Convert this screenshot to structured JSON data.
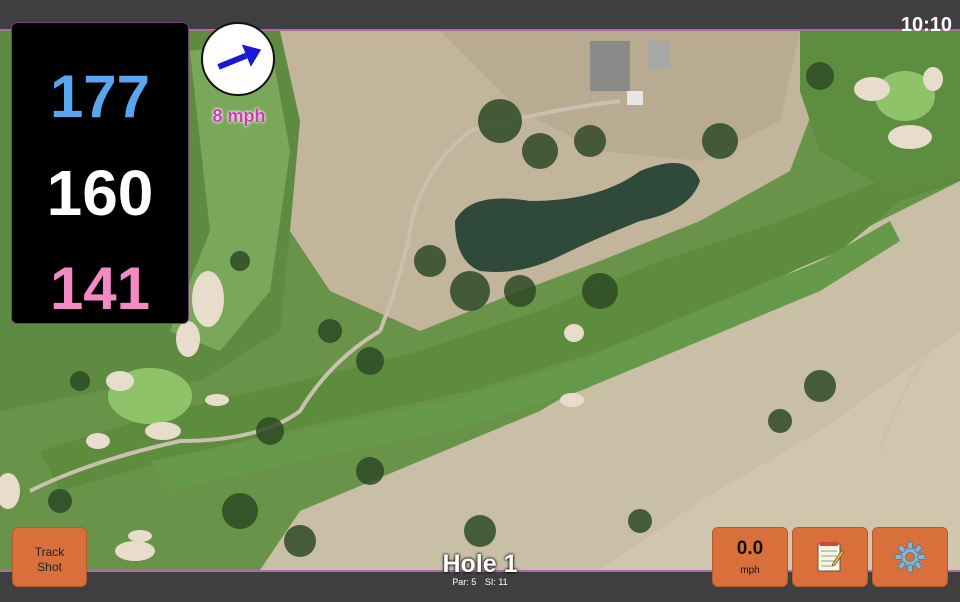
{
  "status": {
    "time": "10:10"
  },
  "distances": {
    "back": "177",
    "middle": "160",
    "front": "141"
  },
  "wind": {
    "speed": "8 mph",
    "direction_icon": "arrow-icon"
  },
  "hole": {
    "title": "Hole 1",
    "par": "Par: 5",
    "si": "SI: 11"
  },
  "buttons": {
    "track_line1": "Track",
    "track_line2": "Shot",
    "speed_value": "0.0",
    "speed_unit": "mph",
    "notes_icon": "notepad-icon",
    "settings_icon": "gear-icon"
  },
  "colors": {
    "back": "#5aa6ee",
    "middle": "#ffffff",
    "front": "#f48ac4",
    "wind_text": "#d03ab8",
    "button": "#d9703c",
    "bar_border": "#b06aa6"
  }
}
